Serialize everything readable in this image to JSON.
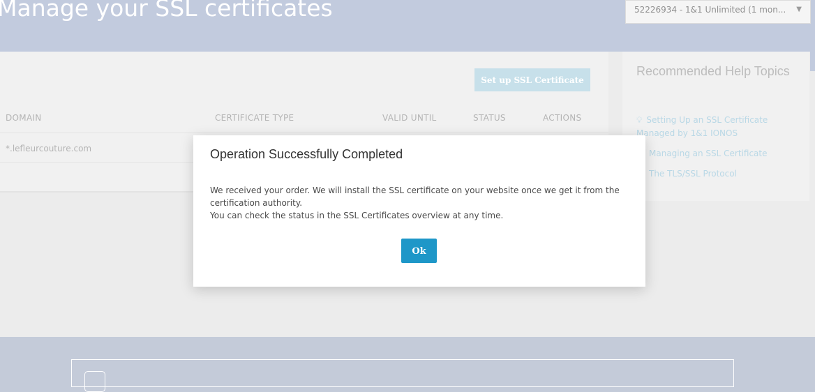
{
  "header": {
    "title": "Manage your SSL certificates",
    "contract_select": {
      "value": "52226934 - 1&1 Unlimited (1 mon...",
      "caret": "▼"
    }
  },
  "card": {
    "setup_button": "Set up SSL Certificate",
    "columns": [
      "DOMAIN",
      "CERTIFICATE TYPE",
      "VALID UNTIL",
      "STATUS",
      "ACTIONS"
    ],
    "rows": [
      {
        "domain": "*.lefleurcouture.com"
      }
    ]
  },
  "help": {
    "title": "Recommended Help Topics",
    "links": [
      {
        "icon": "lightbulb-icon",
        "glyph": "💡︎",
        "label_line1": "Setting Up an SSL Certificate",
        "label_line2": "Managed by 1&1 IONOS"
      },
      {
        "label": "Managing an SSL Certificate"
      },
      {
        "label": "The TLS/SSL Protocol"
      }
    ]
  },
  "modal": {
    "title": "Operation Successfully Completed",
    "line1": "We received your order. We will install the SSL certificate on your website once we get it from the certification authority.",
    "line2": "You can check the status in the SSL Certificates overview at any time.",
    "ok_label": "Ok"
  }
}
